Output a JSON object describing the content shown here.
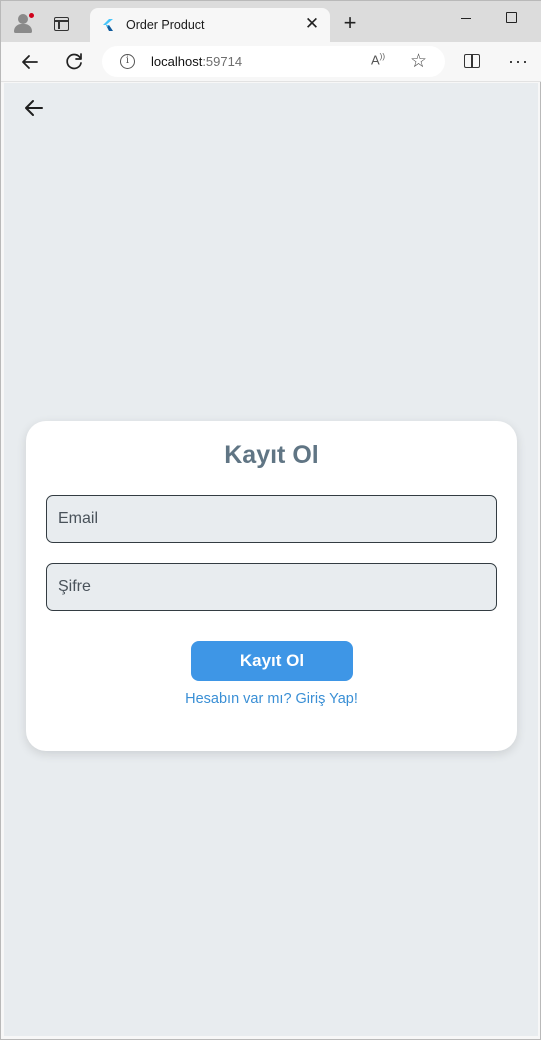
{
  "browser": {
    "tab_title": "Order Product",
    "url_host": "localhost",
    "url_port": ":59714"
  },
  "icons": {
    "profile": "profile-avatar-icon",
    "tabs": "tab-actions-icon",
    "favicon": "flutter-logo-icon",
    "close": "close-icon",
    "new_tab": "plus-icon",
    "back": "arrow-left-icon",
    "reload": "reload-icon",
    "info": "info-icon",
    "read_aloud": "read-aloud-icon",
    "favorite": "star-icon",
    "split": "split-screen-icon",
    "more": "more-horizontal-icon"
  },
  "colors": {
    "page_background": "#e8ecef",
    "card": "#ffffff",
    "title": "#607584",
    "primary_button": "#3e96e6",
    "link": "#3a8fd5"
  },
  "page": {
    "form": {
      "title": "Kayıt Ol",
      "email_placeholder": "Email",
      "password_placeholder": "Şifre",
      "submit_label": "Kayıt Ol",
      "login_link": "Hesabın var mı? Giriş Yap!"
    }
  }
}
